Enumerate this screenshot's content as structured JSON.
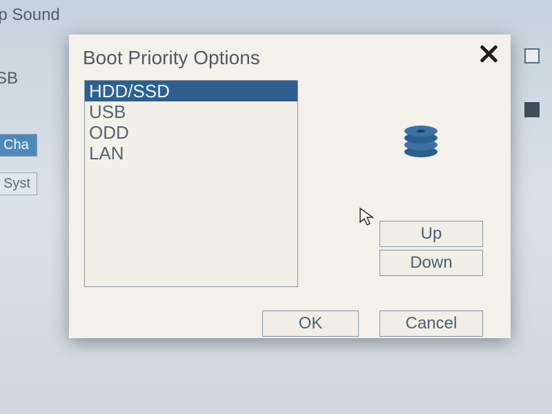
{
  "background": {
    "label_top": "ep Sound",
    "label_sb": "SB",
    "btn_change": "Cha",
    "btn_system": "Syst"
  },
  "dialog": {
    "title": "Boot Priority Options",
    "items": [
      {
        "label": "HDD/SSD",
        "selected": true
      },
      {
        "label": "USB",
        "selected": false
      },
      {
        "label": "ODD",
        "selected": false
      },
      {
        "label": "LAN",
        "selected": false
      }
    ],
    "buttons": {
      "up": "Up",
      "down": "Down",
      "ok": "OK",
      "cancel": "Cancel"
    }
  }
}
